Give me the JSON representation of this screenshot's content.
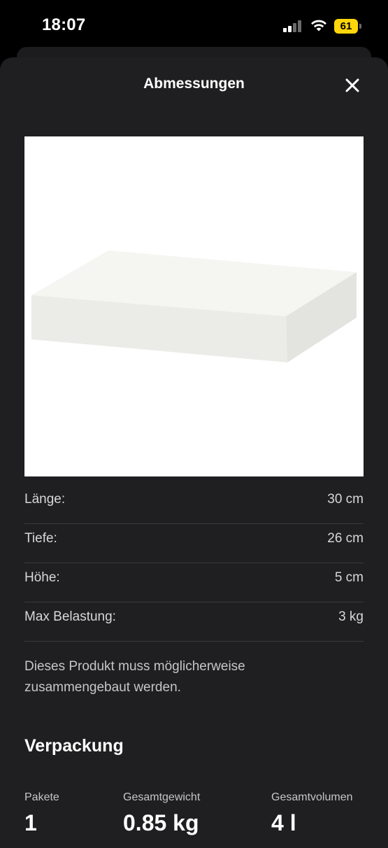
{
  "status_bar": {
    "time": "18:07",
    "battery": "61"
  },
  "sheet": {
    "title": "Abmessungen"
  },
  "specs": [
    {
      "label": "Länge:",
      "value": "30 cm"
    },
    {
      "label": "Tiefe:",
      "value": "26 cm"
    },
    {
      "label": "Höhe:",
      "value": "5 cm"
    },
    {
      "label": "Max Belastung:",
      "value": "3 kg"
    }
  ],
  "assembly_note": "Dieses Produkt muss möglicherweise zusammengebaut werden.",
  "packaging": {
    "heading": "Verpackung",
    "items": [
      {
        "label": "Pakete",
        "value": "1"
      },
      {
        "label": "Gesamtgewicht",
        "value": "0.85 kg"
      },
      {
        "label": "Gesamtvolumen",
        "value": "4 l"
      }
    ]
  },
  "icons": {
    "close": "close-icon",
    "signal": "cellular-signal-icon",
    "wifi": "wifi-icon",
    "battery": "battery-icon"
  },
  "colors": {
    "background": "#000000",
    "sheet": "#1f1f21",
    "divider": "#3a3a3c",
    "battery": "#ffd60a"
  }
}
